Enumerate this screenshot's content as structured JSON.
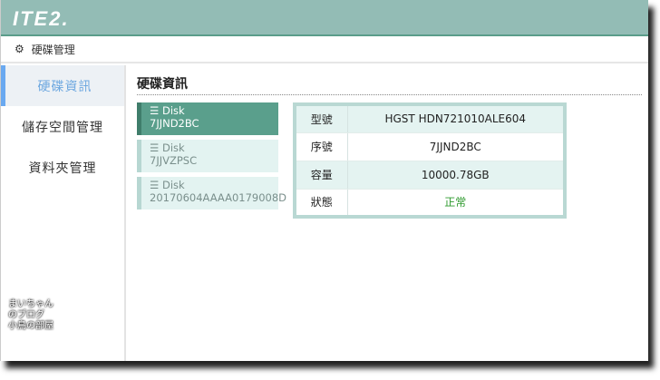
{
  "header": {
    "logo": "ITE2."
  },
  "breadcrumb": {
    "icon": "gear-icon",
    "label": "硬碟管理"
  },
  "sidebar": {
    "items": [
      {
        "label": "硬碟資訊",
        "active": true
      },
      {
        "label": "儲存空間管理"
      },
      {
        "label": "資料夾管理"
      }
    ]
  },
  "main": {
    "title": "硬碟資訊",
    "disks": [
      {
        "label": "Disk",
        "serial": "7JJND2BC",
        "active": true
      },
      {
        "label": "Disk",
        "serial": "7JJVZPSC"
      },
      {
        "label": "Disk",
        "serial": "20170604AAAA0179008D"
      }
    ],
    "info": [
      {
        "key": "型號",
        "value": "HGST HDN721010ALE604"
      },
      {
        "key": "序號",
        "value": "7JJND2BC"
      },
      {
        "key": "容量",
        "value": "10000.78GB"
      },
      {
        "key": "狀態",
        "value": "正常"
      }
    ]
  },
  "watermark": "まいちゃんのブログ 小鳥の部屋"
}
